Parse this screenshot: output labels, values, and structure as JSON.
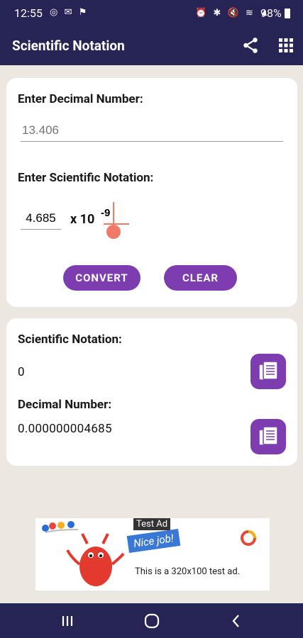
{
  "status": {
    "time": "12:55",
    "left_icons": "◎ ✉ ⚑",
    "right_icons": "⏰ ✱ 🔇 ≋ ▲",
    "battery": "98%"
  },
  "appbar": {
    "title": "Scientific Notation",
    "share_icon": "share-icon",
    "apps_icon": "grid-icon"
  },
  "input_card": {
    "decimal_label": "Enter Decimal Number:",
    "decimal_placeholder": "13.406",
    "sci_label": "Enter Scientific Notation:",
    "mantissa": "4.685",
    "times_ten": "x 10",
    "exponent": "-9",
    "convert_label": "CONVERT",
    "clear_label": "CLEAR"
  },
  "result_card": {
    "sci_label": "Scientific Notation:",
    "sci_value": "0",
    "dec_label": "Decimal Number:",
    "dec_value": "0.000000004685"
  },
  "ad": {
    "tag": "Test Ad",
    "nice": "Nice job!",
    "text": "This is a 320x100 test ad."
  },
  "colors": {
    "bar": "#262455",
    "accent": "#7D3DB0",
    "background": "#ECE8E1",
    "cursor": "#F0796A"
  }
}
